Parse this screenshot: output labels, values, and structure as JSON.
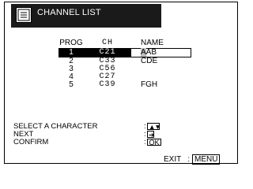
{
  "header": {
    "title": "CHANNEL LIST",
    "icon": "menu-list-icon"
  },
  "table": {
    "columns": [
      "PROG",
      "CH",
      "NAME"
    ],
    "rows": [
      {
        "prog": "1",
        "ch": "C21",
        "name_cursor": "A",
        "name_rest": "AB",
        "selected": true
      },
      {
        "prog": "2",
        "ch": "C33",
        "name": "CDE"
      },
      {
        "prog": "3",
        "ch": "C56",
        "name": ""
      },
      {
        "prog": "4",
        "ch": "C27",
        "name": ""
      },
      {
        "prog": "5",
        "ch": "C39",
        "name": "FGH"
      }
    ]
  },
  "help": {
    "select_label": "SELECT A CHARACTER",
    "select_key": "▲▼",
    "next_label": "NEXT",
    "next_key": "➔",
    "confirm_label": "CONFIRM",
    "confirm_key": "OK"
  },
  "footer": {
    "exit_label": "EXIT",
    "exit_key": "MENU"
  }
}
